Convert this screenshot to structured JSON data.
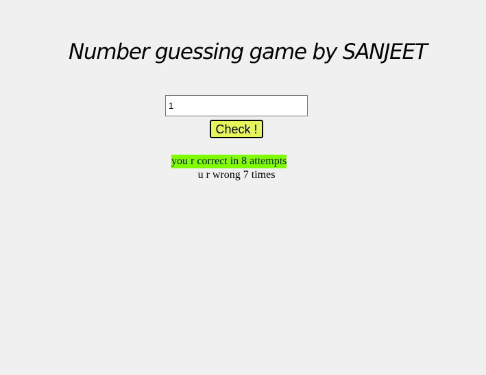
{
  "page": {
    "title": "Number guessing game by SANJEET"
  },
  "form": {
    "guess_value": "1",
    "check_label": "Check !"
  },
  "results": {
    "correct_message": "you r correct in 8 attempts",
    "wrong_message": "u r wrong 7 times"
  },
  "colors": {
    "background": "#f0f0f0",
    "check_button_bg": "#e6f55a",
    "correct_highlight": "#80ff00"
  }
}
